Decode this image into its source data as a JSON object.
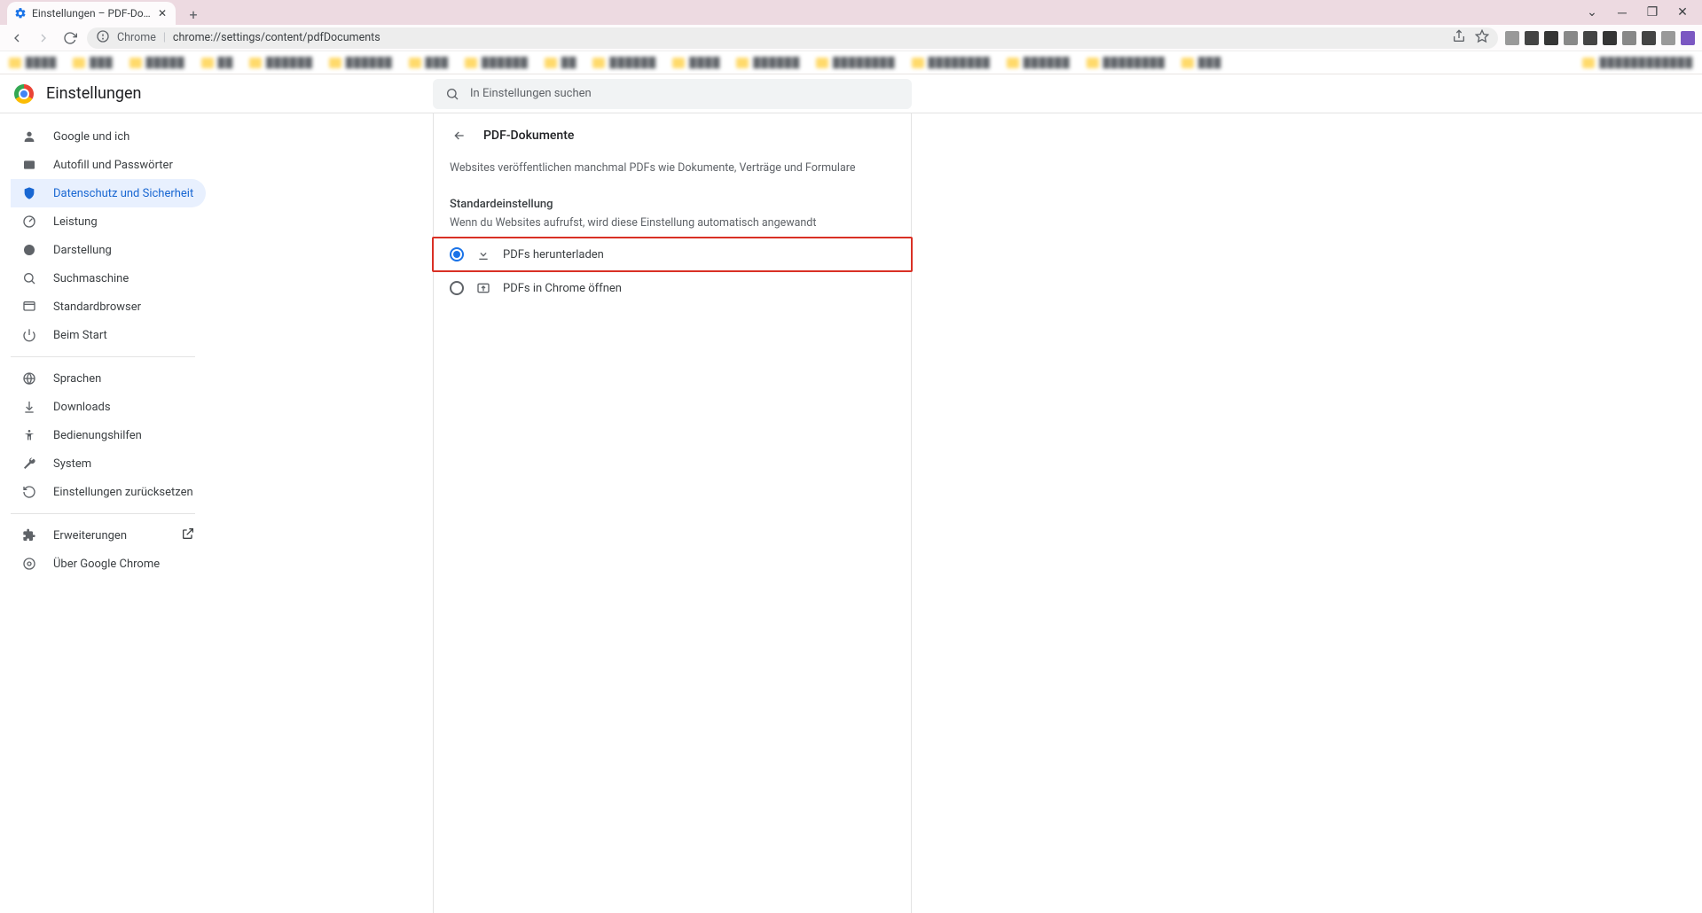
{
  "browser": {
    "tab_title": "Einstellungen – PDF-Dokume",
    "chrome_label": "Chrome",
    "url": "chrome://settings/content/pdfDocuments"
  },
  "app": {
    "title": "Einstellungen",
    "search_placeholder": "In Einstellungen suchen"
  },
  "sidebar": {
    "items": [
      {
        "label": "Google und ich"
      },
      {
        "label": "Autofill und Passwörter"
      },
      {
        "label": "Datenschutz und Sicherheit"
      },
      {
        "label": "Leistung"
      },
      {
        "label": "Darstellung"
      },
      {
        "label": "Suchmaschine"
      },
      {
        "label": "Standardbrowser"
      },
      {
        "label": "Beim Start"
      }
    ],
    "items2": [
      {
        "label": "Sprachen"
      },
      {
        "label": "Downloads"
      },
      {
        "label": "Bedienungshilfen"
      },
      {
        "label": "System"
      },
      {
        "label": "Einstellungen zurücksetzen"
      }
    ],
    "items3": [
      {
        "label": "Erweiterungen"
      },
      {
        "label": "Über Google Chrome"
      }
    ]
  },
  "panel": {
    "title": "PDF-Dokumente",
    "description": "Websites veröffentlichen manchmal PDFs wie Dokumente, Verträge und Formulare",
    "section_title": "Standardeinstellung",
    "section_sub": "Wenn du Websites aufrufst, wird diese Einstellung automatisch angewandt",
    "options": [
      {
        "label": "PDFs herunterladen",
        "selected": true
      },
      {
        "label": "PDFs in Chrome öffnen",
        "selected": false
      }
    ]
  }
}
